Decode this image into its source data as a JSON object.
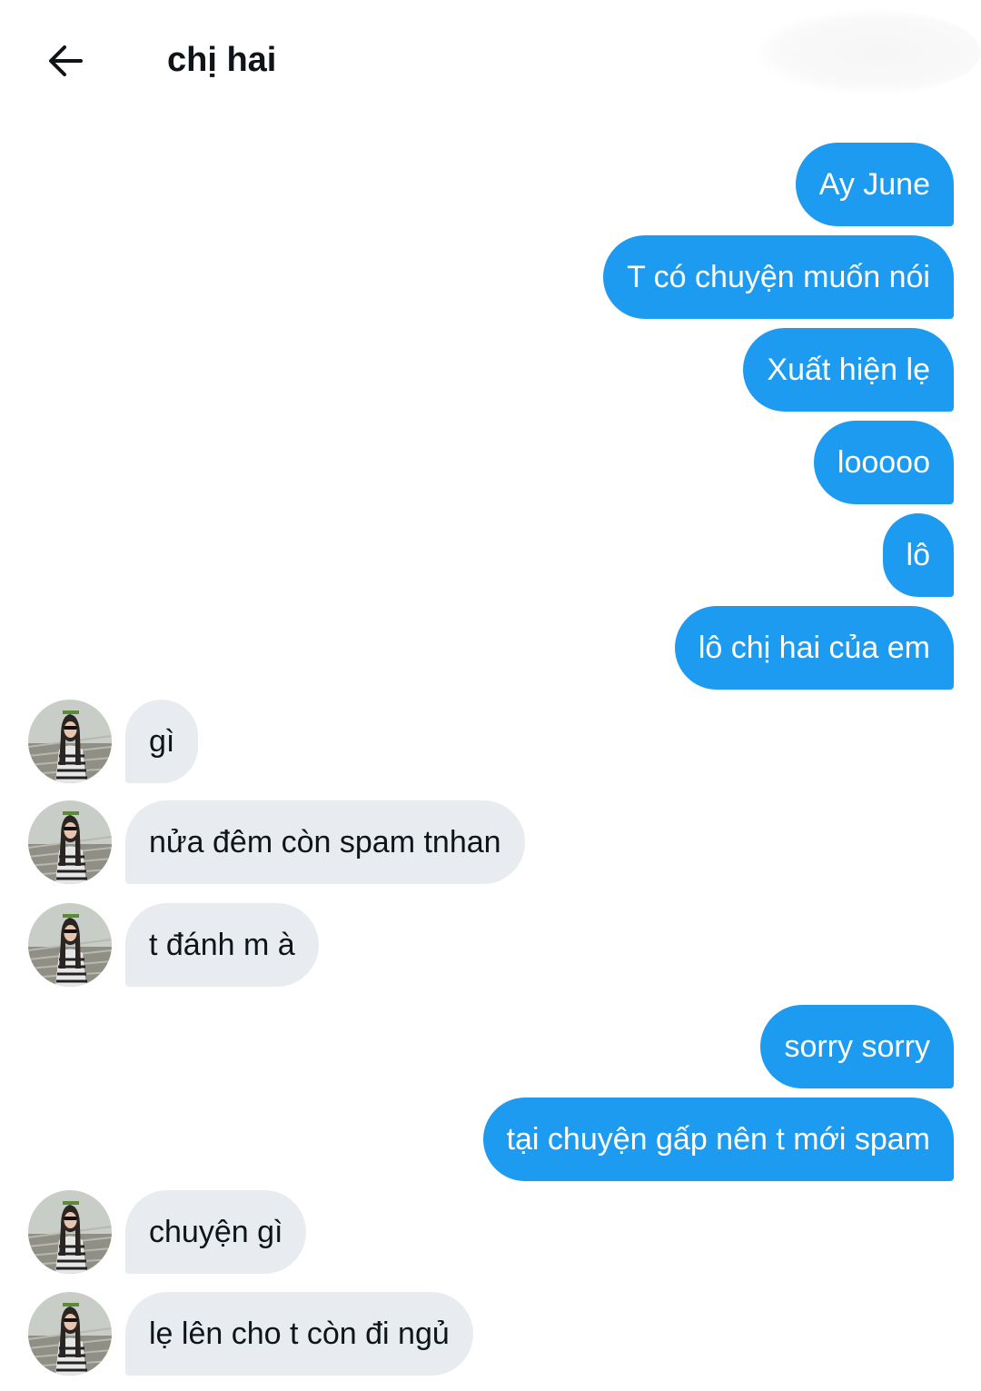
{
  "header": {
    "back_label": "Back",
    "title": "chị hai"
  },
  "messages": [
    {
      "side": "sent",
      "text": "Ay June"
    },
    {
      "side": "sent",
      "text": "T có chuyện muốn nói"
    },
    {
      "side": "sent",
      "text": "Xuất hiện lẹ"
    },
    {
      "side": "sent",
      "text": "looooo"
    },
    {
      "side": "sent",
      "text": "lô"
    },
    {
      "side": "sent",
      "text": "lô chị hai của em"
    },
    {
      "side": "received",
      "text": "gì"
    },
    {
      "side": "received",
      "text": "nửa đêm còn spam tnhan"
    },
    {
      "side": "received",
      "text": "t đánh m à"
    },
    {
      "side": "sent",
      "text": "sorry sorry"
    },
    {
      "side": "sent",
      "text": "tại chuyện gấp nên t mới spam"
    },
    {
      "side": "received",
      "text": "chuyện gì"
    },
    {
      "side": "received",
      "text": "lẹ lên cho t còn đi ngủ"
    }
  ],
  "colors": {
    "sent_bubble": "#1d9bf0",
    "received_bubble": "#e8ecf0",
    "text_dark": "#0f1419"
  },
  "icons": {
    "back": "arrow-left-icon",
    "avatar": "contact-avatar"
  }
}
